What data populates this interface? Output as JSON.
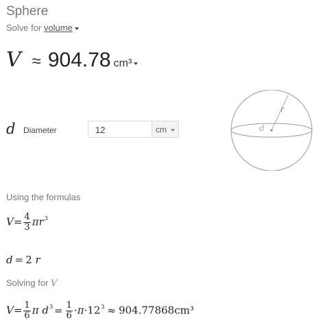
{
  "header": {
    "title": "Sphere",
    "solve_prefix": "Solve for",
    "solve_target": "volume"
  },
  "result": {
    "variable": "V",
    "approx_symbol": "≈",
    "value": "904.78",
    "unit": "cm³"
  },
  "input": {
    "variable": "d",
    "label": "Diameter",
    "value": "12",
    "unit": "cm"
  },
  "diagram": {
    "radius_label": "r",
    "diameter_label": "d"
  },
  "formulas": {
    "heading": "Using the formulas",
    "volume": {
      "lhs": "V",
      "eq": "=",
      "num": "4",
      "den": "3",
      "pi": "π",
      "r": "r",
      "exp": "3"
    },
    "diameter": {
      "lhs": "d",
      "eq": "=",
      "rhs": "2",
      "r": "r"
    }
  },
  "solving": {
    "heading_prefix": "Solving for",
    "heading_var": "V",
    "lhs": "V",
    "eq1": "=",
    "num1": "1",
    "den1": "6",
    "pi1": "π",
    "d": "d",
    "exp1": "3",
    "eq2": "=",
    "num2": "1",
    "den2": "6",
    "dot1": "·",
    "pi2": "π",
    "dot2": "·",
    "base": "12",
    "exp2": "3",
    "approx": "≈",
    "result": "904.77868cm³"
  }
}
